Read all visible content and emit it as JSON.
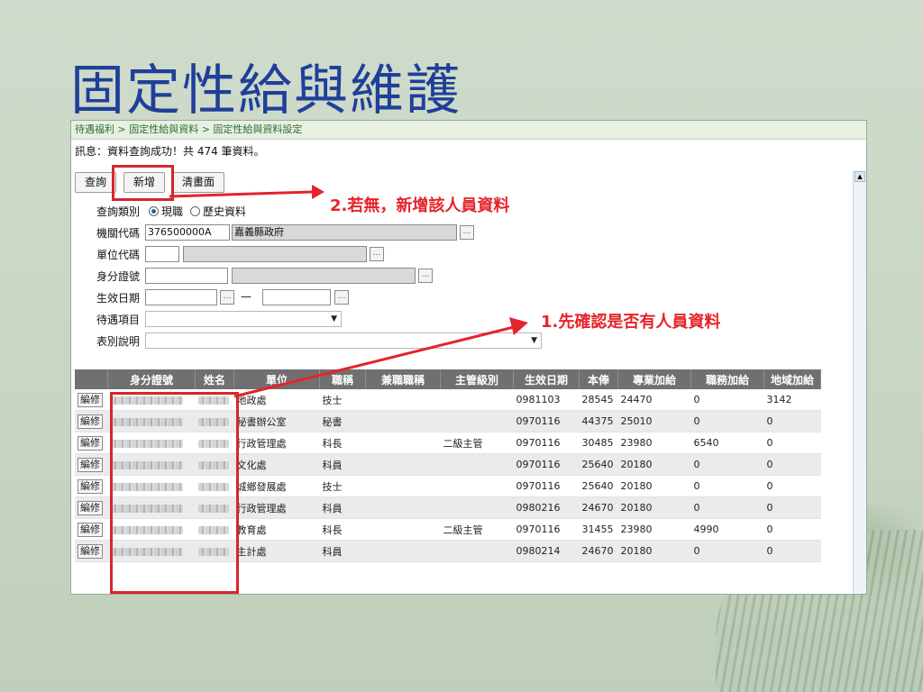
{
  "slide": {
    "title": "固定性給與維護"
  },
  "breadcrumb": "待遇福利 > 固定性給與資料 > 固定性給與資料設定",
  "message": "訊息：資料查詢成功！共 474 筆資料。",
  "toolbar": {
    "query": "查詢",
    "add": "新增",
    "clear": "清畫面"
  },
  "form": {
    "query_type": {
      "label": "查詢類別",
      "options": [
        "現職",
        "歷史資料"
      ],
      "selected": "現職"
    },
    "org_code": {
      "label": "機關代碼",
      "value": "376500000A",
      "name": "嘉義縣政府"
    },
    "unit_code": {
      "label": "單位代碼",
      "value": ""
    },
    "id_number": {
      "label": "身分證號",
      "value": ""
    },
    "effective_date": {
      "label": "生效日期",
      "separator": "—"
    },
    "pay_item": {
      "label": "待遇項目"
    },
    "table_desc": {
      "label": "表別說明"
    },
    "dots": "…"
  },
  "annotations": {
    "step2": "2.若無，新增該人員資料",
    "step1": "1.先確認是否有人員資料"
  },
  "table": {
    "edit_label": "編修",
    "headers": [
      "",
      "身分證號",
      "姓名",
      "單位",
      "職稱",
      "兼職職稱",
      "主管級別",
      "生效日期",
      "本俸",
      "專業加給",
      "職務加給",
      "地域加給"
    ],
    "rows": [
      {
        "unit": "地政處",
        "title": "技士",
        "manager": "",
        "date": "0981103",
        "base": "28545",
        "prof": "24470",
        "duty": "0",
        "region": "3142"
      },
      {
        "unit": "秘書辦公室",
        "title": "秘書",
        "manager": "",
        "date": "0970116",
        "base": "44375",
        "prof": "25010",
        "duty": "0",
        "region": "0"
      },
      {
        "unit": "行政管理處",
        "title": "科長",
        "manager": "二級主管",
        "date": "0970116",
        "base": "30485",
        "prof": "23980",
        "duty": "6540",
        "region": "0"
      },
      {
        "unit": "文化處",
        "title": "科員",
        "manager": "",
        "date": "0970116",
        "base": "25640",
        "prof": "20180",
        "duty": "0",
        "region": "0"
      },
      {
        "unit": "城鄉發展處",
        "title": "技士",
        "manager": "",
        "date": "0970116",
        "base": "25640",
        "prof": "20180",
        "duty": "0",
        "region": "0"
      },
      {
        "unit": "行政管理處",
        "title": "科員",
        "manager": "",
        "date": "0980216",
        "base": "24670",
        "prof": "20180",
        "duty": "0",
        "region": "0"
      },
      {
        "unit": "教育處",
        "title": "科長",
        "manager": "二級主管",
        "date": "0970116",
        "base": "31455",
        "prof": "23980",
        "duty": "4990",
        "region": "0"
      },
      {
        "unit": "主計處",
        "title": "科員",
        "manager": "",
        "date": "0980214",
        "base": "24670",
        "prof": "20180",
        "duty": "0",
        "region": "0"
      }
    ]
  },
  "colors": {
    "title": "#1f3f9a",
    "annotation": "#e5232b",
    "header_bg": "#707070"
  }
}
